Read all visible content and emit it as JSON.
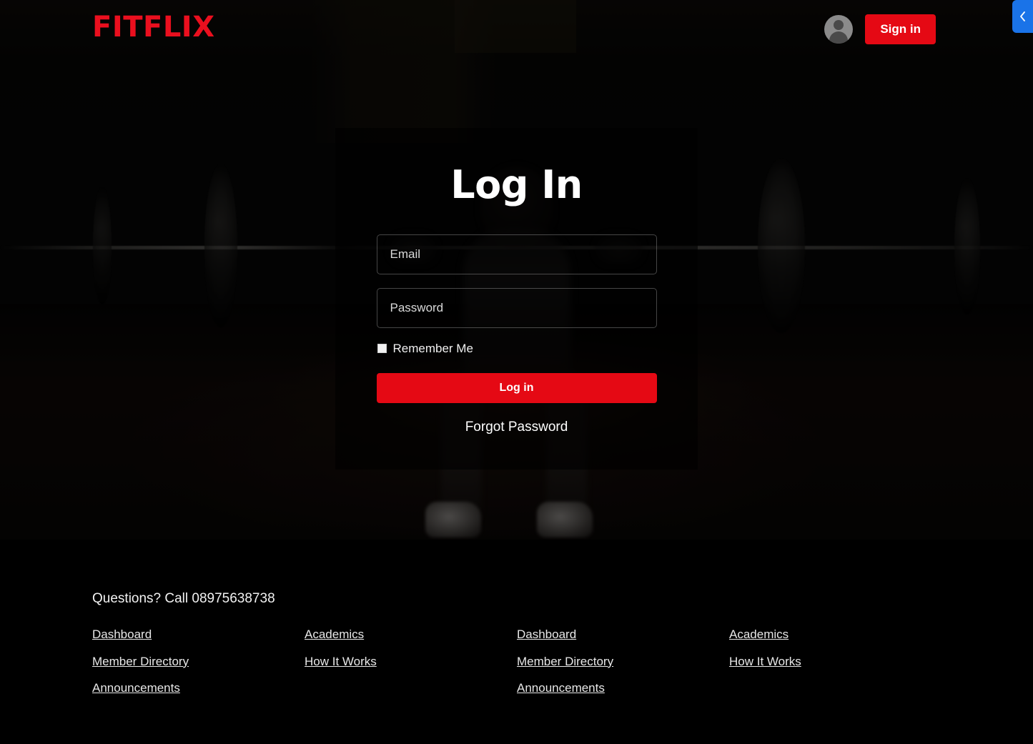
{
  "navbar": {
    "brand": "FITFLIX",
    "avatar_icon": "user-avatar-icon",
    "signin_label": "Sign in",
    "side_tab_icon": "chevron-left-icon",
    "side_tab_color": "#1a73e8"
  },
  "login": {
    "title": "Log In",
    "email_placeholder": "Email",
    "email_value": "",
    "password_placeholder": "Password",
    "password_value": "",
    "remember_label": "Remember Me",
    "remember_checked": false,
    "submit_label": "Log in",
    "forgot_label": "Forgot Password",
    "accent_color": "#e50914"
  },
  "footer": {
    "phone_text": "Questions? Call 08975638738",
    "columns": [
      {
        "links": [
          "Dashboard",
          "Member Directory",
          "Announcements"
        ]
      },
      {
        "links": [
          "Academics",
          "How It Works"
        ]
      },
      {
        "links": [
          "Dashboard",
          "Member Directory",
          "Announcements"
        ]
      },
      {
        "links": [
          "Academics",
          "How It Works"
        ]
      }
    ]
  }
}
